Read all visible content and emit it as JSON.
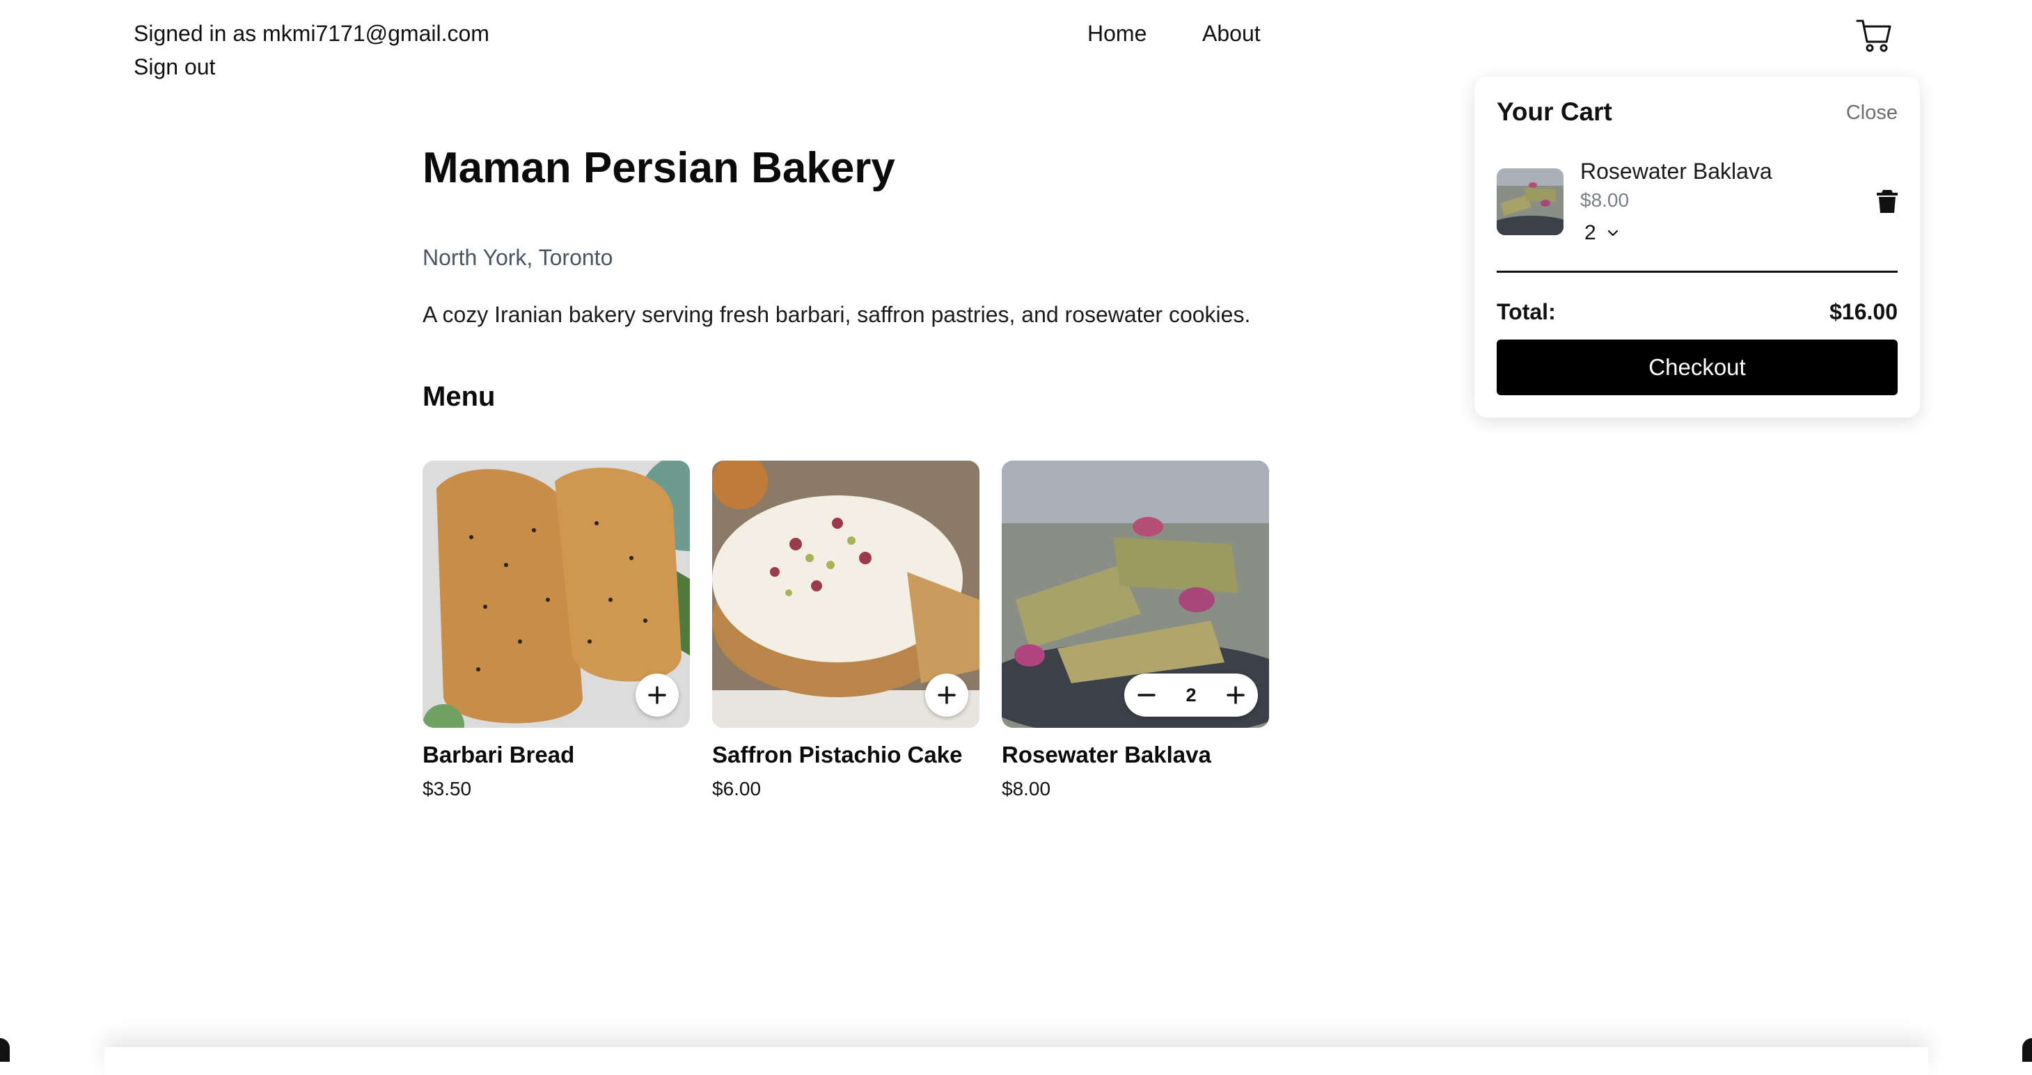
{
  "header": {
    "signed_in_text": "Signed in as mkmi7171@gmail.com",
    "sign_out": "Sign out",
    "nav": [
      "Home",
      "About"
    ],
    "cart_icon": "shopping-cart-icon"
  },
  "bakery": {
    "name": "Maman Persian Bakery",
    "location": "North York, Toronto",
    "description": "A cozy Iranian bakery serving fresh barbari, saffron pastries, and rosewater cookies.",
    "menu_heading": "Menu"
  },
  "menu": [
    {
      "name": "Barbari Bread",
      "price": "$3.50",
      "control": "add"
    },
    {
      "name": "Saffron Pistachio Cake",
      "price": "$6.00",
      "control": "add"
    },
    {
      "name": "Rosewater Baklava",
      "price": "$8.00",
      "control": "stepper",
      "quantity": "2"
    }
  ],
  "cart": {
    "title": "Your Cart",
    "close": "Close",
    "items": [
      {
        "name": "Rosewater Baklava",
        "price": "$8.00",
        "quantity": "2"
      }
    ],
    "total_label": "Total:",
    "total_value": "$16.00",
    "checkout": "Checkout"
  },
  "colors": {
    "accent": "#000000",
    "muted_text": "#4a5563",
    "background": "#ffffff"
  }
}
